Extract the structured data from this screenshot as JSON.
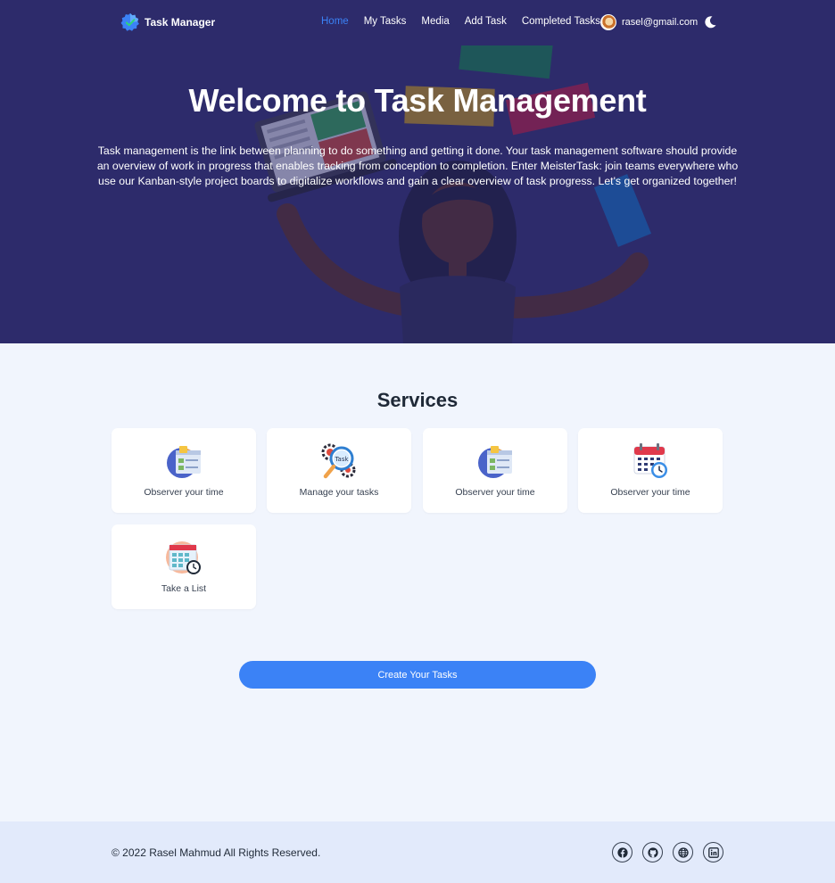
{
  "brand": {
    "name": "Task Manager",
    "logo_icon": "badge-check-icon",
    "logo_color": "#3b82f6"
  },
  "nav": {
    "items": [
      {
        "label": "Home",
        "active": true
      },
      {
        "label": "My Tasks",
        "active": false
      },
      {
        "label": "Media",
        "active": false
      },
      {
        "label": "Add Task",
        "active": false
      },
      {
        "label": "Completed Tasks",
        "active": false
      }
    ],
    "user_email": "rasel@gmail.com",
    "theme_icon": "moon-icon"
  },
  "hero": {
    "title": "Welcome to Task Management",
    "text": "Task management is the link between planning to do something and getting it done. Your task management software should provide an overview of work in progress that enables tracking from conception to completion. Enter MeisterTask: join teams everywhere who use our Kanban-style project boards to digitalize workflows and gain a clear overview of task progress. Let's get organized together!",
    "background_color": "#2d2b6b"
  },
  "services": {
    "title": "Services",
    "cards": [
      {
        "label": "Observer your time",
        "icon": "clipboard-chart-icon"
      },
      {
        "label": "Manage your tasks",
        "icon": "task-magnifier-gear-icon",
        "icon_text": "Task"
      },
      {
        "label": "Observer your time",
        "icon": "clipboard-chart-icon"
      },
      {
        "label": "Observer your time",
        "icon": "calendar-clock-icon"
      },
      {
        "label": "Take a List",
        "icon": "calendar-list-clock-icon"
      }
    ]
  },
  "cta": {
    "label": "Create Your Tasks",
    "color": "#3b82f6"
  },
  "footer": {
    "copyright": "© 2022 Rasel Mahmud All Rights Reserved.",
    "social": [
      "facebook-icon",
      "github-icon",
      "globe-icon",
      "linkedin-icon"
    ]
  }
}
